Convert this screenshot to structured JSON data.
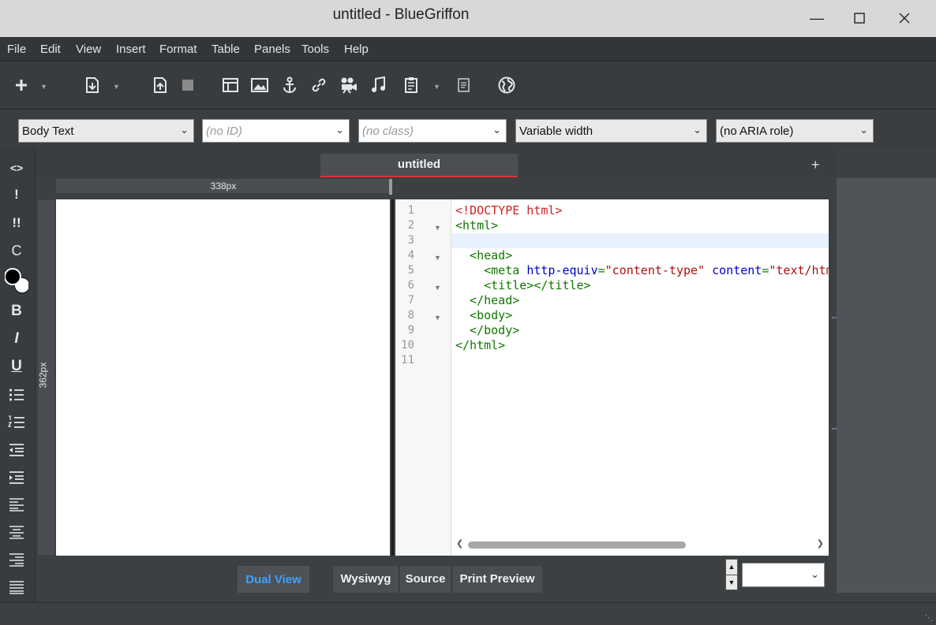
{
  "window": {
    "title": "untitled - BlueGriffon"
  },
  "menu": {
    "items": [
      "File",
      "Edit",
      "View",
      "Insert",
      "Format",
      "Table",
      "Panels",
      "Tools",
      "Help"
    ]
  },
  "toolbar": {
    "icons": [
      "new-icon",
      "open-file-icon",
      "publish-icon",
      "stop-icon",
      "table-icon",
      "image-icon",
      "anchor-icon",
      "link-icon",
      "video-icon",
      "audio-icon",
      "form-icon",
      "notes-icon",
      "globe-icon"
    ]
  },
  "format_bar": {
    "paragraph_format": "Body Text",
    "id_select": "(no ID)",
    "class_select": "(no class)",
    "width_select": "Variable width",
    "aria_role_select": "(no ARIA role)"
  },
  "left_tools": {
    "items": [
      "<>",
      "!",
      "!!",
      "C",
      "B",
      "I",
      "U"
    ]
  },
  "tab": {
    "label": "untitled",
    "add": "+"
  },
  "rulers": {
    "width_label": "338px",
    "height_label": "362px"
  },
  "source": {
    "line_numbers": [
      "1",
      "2",
      "3",
      "4",
      "5",
      "6",
      "7",
      "8",
      "9",
      "10",
      "11"
    ]
  },
  "bottom": {
    "dual_view": "Dual View",
    "wysiwyg": "Wysiwyg",
    "source": "Source",
    "print_preview": "Print Preview",
    "zoom_value": ""
  },
  "colors": {
    "accent": "#3aa3ff",
    "tab_underline": "#dd3333",
    "doctype": "#cc2222",
    "tag": "#117700",
    "attr": "#0000cc",
    "string": "#aa1111"
  }
}
